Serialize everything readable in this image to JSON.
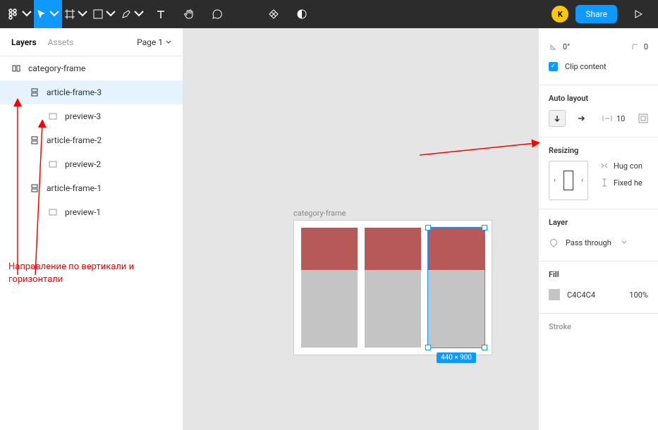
{
  "toolbar": {
    "avatar_letter": "K",
    "share_label": "Share"
  },
  "left_panel": {
    "tabs": {
      "layers": "Layers",
      "assets": "Assets"
    },
    "page_label": "Page 1",
    "layers": [
      {
        "name": "category-frame",
        "indent": 0,
        "type": "auto-h",
        "selected": false
      },
      {
        "name": "article-frame-3",
        "indent": 1,
        "type": "auto-v",
        "selected": true
      },
      {
        "name": "preview-3",
        "indent": 2,
        "type": "rect",
        "selected": false
      },
      {
        "name": "article-frame-2",
        "indent": 1,
        "type": "auto-v",
        "selected": false
      },
      {
        "name": "preview-2",
        "indent": 2,
        "type": "rect",
        "selected": false
      },
      {
        "name": "article-frame-1",
        "indent": 1,
        "type": "auto-v",
        "selected": false
      },
      {
        "name": "preview-1",
        "indent": 2,
        "type": "rect",
        "selected": false
      }
    ]
  },
  "annotation": {
    "text": "Направление по вертикали и горизонтали"
  },
  "canvas": {
    "frame_label": "category-frame",
    "size_badge": "440 × 900"
  },
  "right_panel": {
    "rotation": "0°",
    "corner": "0",
    "clip_label": "Clip content",
    "auto_layout": {
      "title": "Auto layout",
      "spacing": "10"
    },
    "resizing": {
      "title": "Resizing",
      "hug": "Hug con",
      "fixed": "Fixed he"
    },
    "layer": {
      "title": "Layer",
      "mode": "Pass through"
    },
    "fill": {
      "title": "Fill",
      "hex": "C4C4C4",
      "opacity": "100%"
    },
    "stroke": {
      "title": "Stroke"
    }
  }
}
